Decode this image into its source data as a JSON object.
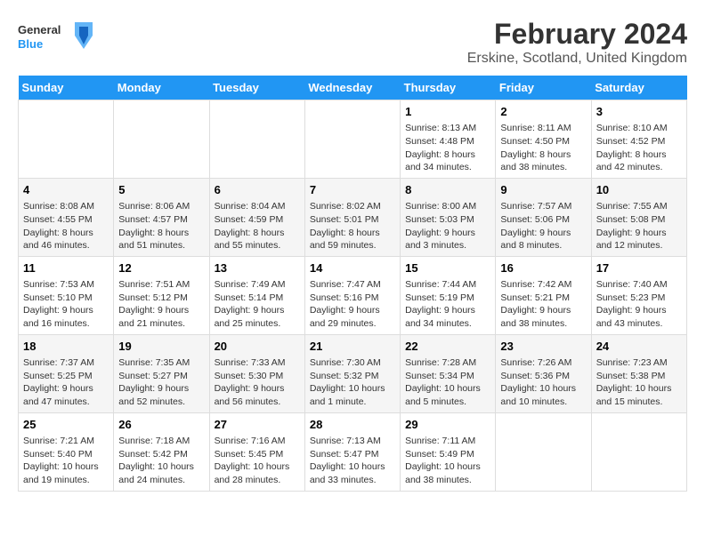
{
  "header": {
    "logo_general": "General",
    "logo_blue": "Blue",
    "title": "February 2024",
    "subtitle": "Erskine, Scotland, United Kingdom"
  },
  "days_of_week": [
    "Sunday",
    "Monday",
    "Tuesday",
    "Wednesday",
    "Thursday",
    "Friday",
    "Saturday"
  ],
  "weeks": [
    [
      {
        "day": "",
        "info": ""
      },
      {
        "day": "",
        "info": ""
      },
      {
        "day": "",
        "info": ""
      },
      {
        "day": "",
        "info": ""
      },
      {
        "day": "1",
        "info": "Sunrise: 8:13 AM\nSunset: 4:48 PM\nDaylight: 8 hours and 34 minutes."
      },
      {
        "day": "2",
        "info": "Sunrise: 8:11 AM\nSunset: 4:50 PM\nDaylight: 8 hours and 38 minutes."
      },
      {
        "day": "3",
        "info": "Sunrise: 8:10 AM\nSunset: 4:52 PM\nDaylight: 8 hours and 42 minutes."
      }
    ],
    [
      {
        "day": "4",
        "info": "Sunrise: 8:08 AM\nSunset: 4:55 PM\nDaylight: 8 hours and 46 minutes."
      },
      {
        "day": "5",
        "info": "Sunrise: 8:06 AM\nSunset: 4:57 PM\nDaylight: 8 hours and 51 minutes."
      },
      {
        "day": "6",
        "info": "Sunrise: 8:04 AM\nSunset: 4:59 PM\nDaylight: 8 hours and 55 minutes."
      },
      {
        "day": "7",
        "info": "Sunrise: 8:02 AM\nSunset: 5:01 PM\nDaylight: 8 hours and 59 minutes."
      },
      {
        "day": "8",
        "info": "Sunrise: 8:00 AM\nSunset: 5:03 PM\nDaylight: 9 hours and 3 minutes."
      },
      {
        "day": "9",
        "info": "Sunrise: 7:57 AM\nSunset: 5:06 PM\nDaylight: 9 hours and 8 minutes."
      },
      {
        "day": "10",
        "info": "Sunrise: 7:55 AM\nSunset: 5:08 PM\nDaylight: 9 hours and 12 minutes."
      }
    ],
    [
      {
        "day": "11",
        "info": "Sunrise: 7:53 AM\nSunset: 5:10 PM\nDaylight: 9 hours and 16 minutes."
      },
      {
        "day": "12",
        "info": "Sunrise: 7:51 AM\nSunset: 5:12 PM\nDaylight: 9 hours and 21 minutes."
      },
      {
        "day": "13",
        "info": "Sunrise: 7:49 AM\nSunset: 5:14 PM\nDaylight: 9 hours and 25 minutes."
      },
      {
        "day": "14",
        "info": "Sunrise: 7:47 AM\nSunset: 5:16 PM\nDaylight: 9 hours and 29 minutes."
      },
      {
        "day": "15",
        "info": "Sunrise: 7:44 AM\nSunset: 5:19 PM\nDaylight: 9 hours and 34 minutes."
      },
      {
        "day": "16",
        "info": "Sunrise: 7:42 AM\nSunset: 5:21 PM\nDaylight: 9 hours and 38 minutes."
      },
      {
        "day": "17",
        "info": "Sunrise: 7:40 AM\nSunset: 5:23 PM\nDaylight: 9 hours and 43 minutes."
      }
    ],
    [
      {
        "day": "18",
        "info": "Sunrise: 7:37 AM\nSunset: 5:25 PM\nDaylight: 9 hours and 47 minutes."
      },
      {
        "day": "19",
        "info": "Sunrise: 7:35 AM\nSunset: 5:27 PM\nDaylight: 9 hours and 52 minutes."
      },
      {
        "day": "20",
        "info": "Sunrise: 7:33 AM\nSunset: 5:30 PM\nDaylight: 9 hours and 56 minutes."
      },
      {
        "day": "21",
        "info": "Sunrise: 7:30 AM\nSunset: 5:32 PM\nDaylight: 10 hours and 1 minute."
      },
      {
        "day": "22",
        "info": "Sunrise: 7:28 AM\nSunset: 5:34 PM\nDaylight: 10 hours and 5 minutes."
      },
      {
        "day": "23",
        "info": "Sunrise: 7:26 AM\nSunset: 5:36 PM\nDaylight: 10 hours and 10 minutes."
      },
      {
        "day": "24",
        "info": "Sunrise: 7:23 AM\nSunset: 5:38 PM\nDaylight: 10 hours and 15 minutes."
      }
    ],
    [
      {
        "day": "25",
        "info": "Sunrise: 7:21 AM\nSunset: 5:40 PM\nDaylight: 10 hours and 19 minutes."
      },
      {
        "day": "26",
        "info": "Sunrise: 7:18 AM\nSunset: 5:42 PM\nDaylight: 10 hours and 24 minutes."
      },
      {
        "day": "27",
        "info": "Sunrise: 7:16 AM\nSunset: 5:45 PM\nDaylight: 10 hours and 28 minutes."
      },
      {
        "day": "28",
        "info": "Sunrise: 7:13 AM\nSunset: 5:47 PM\nDaylight: 10 hours and 33 minutes."
      },
      {
        "day": "29",
        "info": "Sunrise: 7:11 AM\nSunset: 5:49 PM\nDaylight: 10 hours and 38 minutes."
      },
      {
        "day": "",
        "info": ""
      },
      {
        "day": "",
        "info": ""
      }
    ]
  ]
}
